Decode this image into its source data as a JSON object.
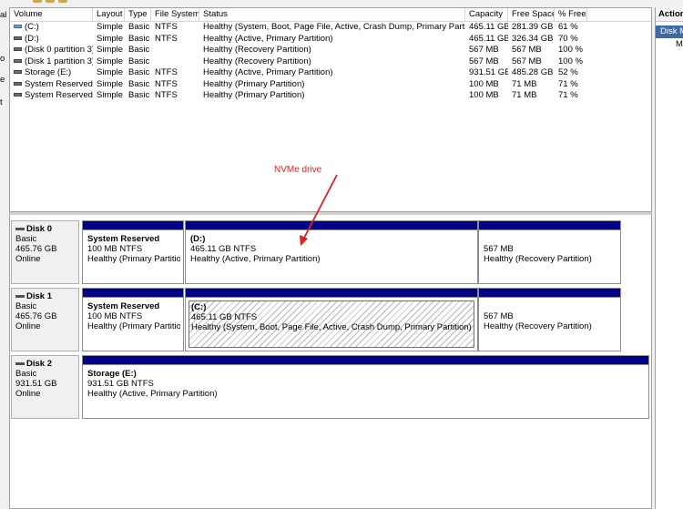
{
  "left_strip": {
    "fragments": [
      "al",
      "o",
      "e",
      "t"
    ]
  },
  "volume_list": {
    "columns": [
      "Volume",
      "Layout",
      "Type",
      "File System",
      "Status",
      "Capacity",
      "Free Space",
      "% Free"
    ],
    "rows": [
      {
        "volume": "(C:)",
        "layout": "Simple",
        "type": "Basic",
        "fs": "NTFS",
        "status": "Healthy (System, Boot, Page File, Active, Crash Dump, Primary Partition)",
        "capacity": "465.11 GB",
        "free": "281.39 GB",
        "pct": "61 %"
      },
      {
        "volume": "(D:)",
        "layout": "Simple",
        "type": "Basic",
        "fs": "NTFS",
        "status": "Healthy (Active, Primary Partition)",
        "capacity": "465.11 GB",
        "free": "326.34 GB",
        "pct": "70 %"
      },
      {
        "volume": "(Disk 0 partition 3)",
        "layout": "Simple",
        "type": "Basic",
        "fs": "",
        "status": "Healthy (Recovery Partition)",
        "capacity": "567 MB",
        "free": "567 MB",
        "pct": "100 %"
      },
      {
        "volume": "(Disk 1 partition 3)",
        "layout": "Simple",
        "type": "Basic",
        "fs": "",
        "status": "Healthy (Recovery Partition)",
        "capacity": "567 MB",
        "free": "567 MB",
        "pct": "100 %"
      },
      {
        "volume": "Storage (E:)",
        "layout": "Simple",
        "type": "Basic",
        "fs": "NTFS",
        "status": "Healthy (Active, Primary Partition)",
        "capacity": "931.51 GB",
        "free": "485.28 GB",
        "pct": "52 %"
      },
      {
        "volume": "System Reserved",
        "layout": "Simple",
        "type": "Basic",
        "fs": "NTFS",
        "status": "Healthy (Primary Partition)",
        "capacity": "100 MB",
        "free": "71 MB",
        "pct": "71 %"
      },
      {
        "volume": "System Reserved",
        "layout": "Simple",
        "type": "Basic",
        "fs": "NTFS",
        "status": "Healthy (Primary Partition)",
        "capacity": "100 MB",
        "free": "71 MB",
        "pct": "71 %"
      }
    ]
  },
  "annotation": {
    "text": "NVMe drive",
    "color": "#e02020"
  },
  "disks": [
    {
      "name": "Disk 0",
      "type": "Basic",
      "size": "465.76 GB",
      "status": "Online",
      "partitions": [
        {
          "name": "System Reserved",
          "size": "100 MB NTFS",
          "status": "Healthy (Primary Partition"
        },
        {
          "name": "(D:)",
          "size": "465.11 GB NTFS",
          "status": "Healthy (Active, Primary Partition)"
        },
        {
          "name": "",
          "size": "567 MB",
          "status": "Healthy (Recovery Partition)"
        }
      ]
    },
    {
      "name": "Disk 1",
      "type": "Basic",
      "size": "465.76 GB",
      "status": "Online",
      "partitions": [
        {
          "name": "System Reserved",
          "size": "100 MB NTFS",
          "status": "Healthy (Primary Partition"
        },
        {
          "name": "(C:)",
          "size": "465.11 GB NTFS",
          "status": "Healthy (System, Boot, Page File, Active, Crash Dump, Primary Partition)"
        },
        {
          "name": "",
          "size": "567 MB",
          "status": "Healthy (Recovery Partition)"
        }
      ]
    },
    {
      "name": "Disk 2",
      "type": "Basic",
      "size": "931.51 GB",
      "status": "Online",
      "partitions": [
        {
          "name": "Storage  (E:)",
          "size": "931.51 GB NTFS",
          "status": "Healthy (Active, Primary Partition)"
        }
      ]
    }
  ],
  "action_pane": {
    "title": "Action",
    "section": "Disk M",
    "item": "M"
  },
  "colors": {
    "partition_bar": "#00008b",
    "selection": "#3b6aa5",
    "annotation": "#e02020"
  }
}
